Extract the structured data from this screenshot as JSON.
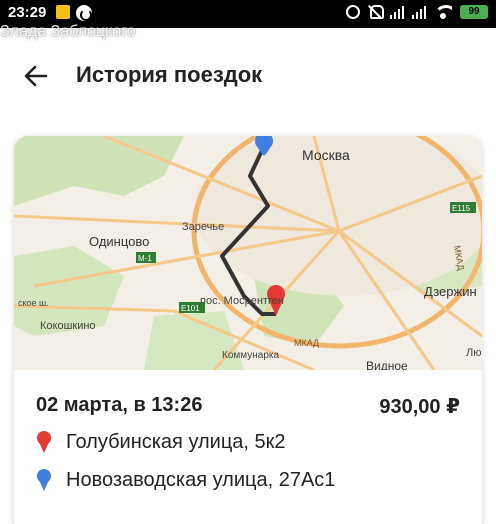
{
  "status_bar": {
    "time": "23:29",
    "battery": "99",
    "battery_color": "#4caf50"
  },
  "watermark": "Злада Заблоцкого",
  "header": {
    "title": "История поездок",
    "back_icon": "arrow-back-icon"
  },
  "trip": {
    "date": "02 марта, в 13:26",
    "price": "930,00 ₽",
    "from_address": "Голубинская улица, 5к2",
    "to_address": "Новозаводская улица, 27Ас1",
    "from_pin_color": "#e53935",
    "to_pin_color": "#3f7fe0"
  },
  "map": {
    "labels": {
      "moskva": "Москва",
      "odintsovo": "Одинцово",
      "zarechye": "Заречье",
      "mosrentgen": "пос. Мосрентген",
      "kokoshkino": "Кокошкино",
      "kommunarka": "Коммунарка",
      "dzerzhin": "Дзержин",
      "vidnoe": "Видное",
      "mkad": "МКАД",
      "mkad2": "МКАД",
      "e101": "E101",
      "e115": "E115",
      "m1": "M-1",
      "liu": "Лю",
      "sk": "ское ш."
    }
  }
}
